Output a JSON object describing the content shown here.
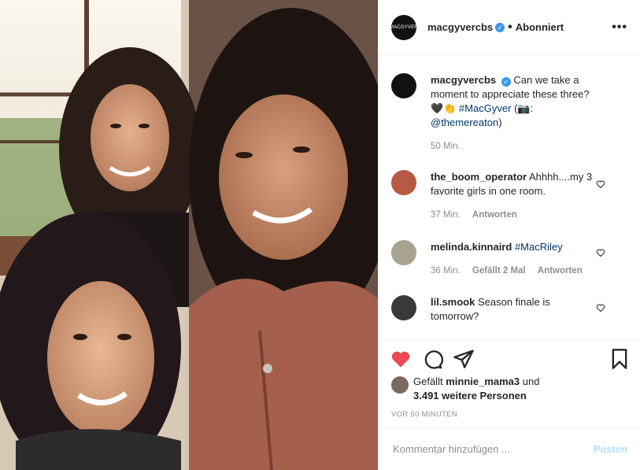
{
  "header": {
    "username": "macgyvercbs",
    "verified_glyph": "✓",
    "separator": "•",
    "follow_status": "Abonniert",
    "more_glyph": "•••",
    "avatar_text": "MACGYVER"
  },
  "caption": {
    "username": "macgyvercbs",
    "text": "Can we take a moment to appreciate these three?",
    "emoji_line": "🖤👏",
    "hashtag": "#MacGyver",
    "credit_prefix": "(📷:",
    "mention": "@themereaton",
    "credit_suffix": ")",
    "time": "50 Min."
  },
  "comments": [
    {
      "username": "the_boom_operator",
      "text": "Ahhhh....my 3 favorite girls in one room.",
      "time": "37 Min.",
      "likes": "",
      "reply": "Antworten"
    },
    {
      "username": "melinda.kinnaird",
      "text": "#MacRiley",
      "time": "36 Min.",
      "likes": "Gefällt 2 Mal",
      "reply": "Antworten"
    },
    {
      "username": "lil.smook",
      "text": "Season finale is tomorrow?",
      "time": "",
      "likes": "",
      "reply": ""
    }
  ],
  "actions": {
    "like_active": true,
    "like_color": "#ed4956"
  },
  "likes": {
    "prefix": "Gefällt",
    "user": "minnie_mama3",
    "middle": "und",
    "count": "3.491 weitere Personen"
  },
  "timestamp": "VOR 50 MINUTEN",
  "add_comment": {
    "placeholder": "Kommentar hinzufügen ...",
    "post_label": "Posten"
  },
  "colors": {
    "accent": "#3897f0",
    "muted": "#8e8e8e",
    "link": "#00376b",
    "post_disabled": "#b2dffc"
  }
}
